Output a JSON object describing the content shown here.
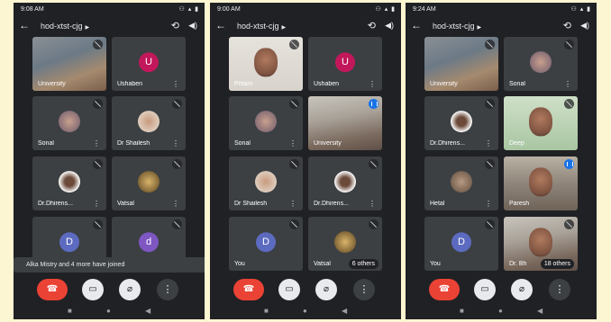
{
  "phones": [
    {
      "time": "9:08 AM",
      "meeting": "hod-xtst-cjg",
      "tiles": [
        {
          "name": "University",
          "kind": "video"
        },
        {
          "name": "Ushaben",
          "initial": "U",
          "color": "#c2185b"
        },
        {
          "name": "Sonal"
        },
        {
          "name": "Dr Shailesh"
        },
        {
          "name": "Dr.Dhirens..."
        },
        {
          "name": "Vatsal"
        },
        {
          "name": "",
          "initial": "D",
          "color": "#5c6bc0"
        },
        {
          "name": "",
          "initial": "d",
          "color": "#7e57c2"
        }
      ],
      "toast": "Alka Mistry and 4 more have joined"
    },
    {
      "time": "9:00 AM",
      "meeting": "hod-xtst-cjg",
      "tiles": [
        {
          "name": "Pritam",
          "kind": "video"
        },
        {
          "name": "Ushaben",
          "initial": "U",
          "color": "#c2185b"
        },
        {
          "name": "Sonal"
        },
        {
          "name": "University",
          "kind": "video"
        },
        {
          "name": "Dr Shailesh"
        },
        {
          "name": "Dr.Dhirens..."
        },
        {
          "name": "You",
          "initial": "D",
          "color": "#5c6bc0"
        },
        {
          "name": "Vatsal",
          "others": "6 others"
        }
      ]
    },
    {
      "time": "9:24 AM",
      "meeting": "hod-xtst-cjg",
      "tiles": [
        {
          "name": "University",
          "kind": "video"
        },
        {
          "name": "Sonal"
        },
        {
          "name": "Dr.Dhirens..."
        },
        {
          "name": "Deep",
          "kind": "video"
        },
        {
          "name": "Hetal"
        },
        {
          "name": "Paresh",
          "kind": "video"
        },
        {
          "name": "You",
          "initial": "D",
          "color": "#5c6bc0"
        },
        {
          "name": "Dr. Bh",
          "others": "18 others",
          "kind": "video"
        }
      ]
    }
  ],
  "icons": {
    "back": "arrow-left-icon",
    "caret": "caret-right-icon",
    "flip": "camera-flip-icon",
    "speaker": "speaker-icon",
    "mic_off": "mic-off-icon",
    "more": "more-vert-icon",
    "end_call": "end-call-icon",
    "camera_off": "camera-off-icon",
    "mic_toggle": "mic-off-icon",
    "more_options": "more-options-icon"
  },
  "colors": {
    "background": "#fdf6d2",
    "phone": "#202124",
    "tile": "#3c4043",
    "end_call": "#ea4335",
    "speaking": "#1a73e8"
  }
}
